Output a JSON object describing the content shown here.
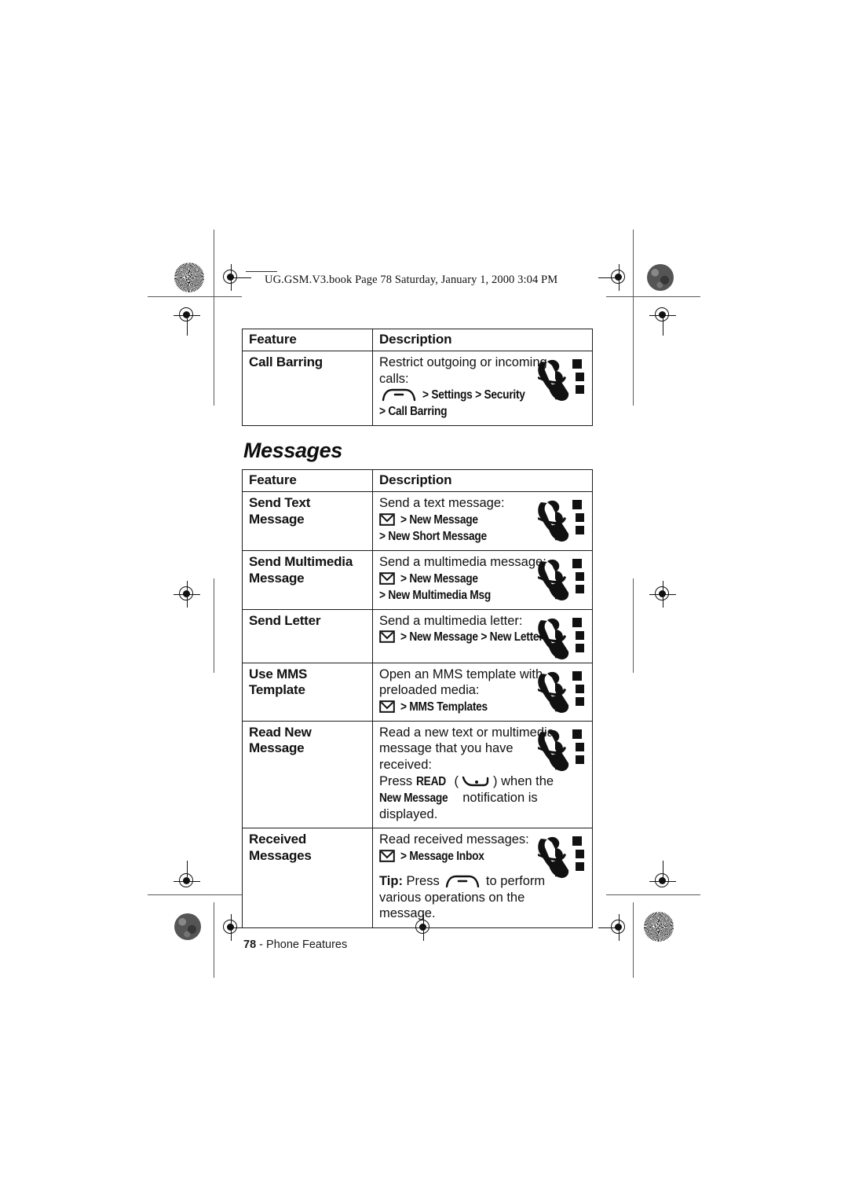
{
  "header": {
    "slug": "UG.GSM.V3.book  Page 78  Saturday, January 1, 2000  3:04 PM"
  },
  "table_call": {
    "headers": {
      "feature": "Feature",
      "description": "Description"
    },
    "rows": [
      {
        "feature": "Call Barring",
        "lines": [
          {
            "text": "Restrict outgoing or incoming"
          },
          {
            "text": "calls:"
          },
          {
            "icon": "menu-key-icon",
            "screen_before": "",
            "text": "> Settings > Security",
            "screen": true
          },
          {
            "text": "> Call Barring",
            "screen": true
          }
        ],
        "phone_icon": "flip-phone-icon"
      }
    ]
  },
  "section": {
    "title": "Messages"
  },
  "table_messages": {
    "headers": {
      "feature": "Feature",
      "description": "Description"
    },
    "rows": [
      {
        "feature": "Send Text Message",
        "lines": [
          {
            "text": "Send a text message:"
          },
          {
            "icon": "envelope-icon",
            "text": "> New Message",
            "screen": true
          },
          {
            "text": "> New Short Message",
            "screen": true
          }
        ],
        "phone_icon": "flip-phone-icon"
      },
      {
        "feature": "Send Multimedia Message",
        "lines": [
          {
            "text": "Send a multimedia message:"
          },
          {
            "icon": "envelope-icon",
            "text": "> New Message",
            "screen": true
          },
          {
            "text": "> New Multimedia Msg",
            "screen": true
          }
        ],
        "phone_icon": "flip-phone-icon"
      },
      {
        "feature": "Send Letter",
        "lines": [
          {
            "text": "Send a multimedia letter:"
          },
          {
            "icon": "envelope-icon",
            "text": "> New Message > New Letter",
            "screen": true
          }
        ],
        "phone_icon": "flip-phone-icon"
      },
      {
        "feature": "Use MMS Template",
        "lines": [
          {
            "text": "Open an MMS template with"
          },
          {
            "text": "preloaded media:"
          },
          {
            "icon": "envelope-icon",
            "text": "> MMS Templates",
            "screen": true
          }
        ],
        "phone_icon": "flip-phone-icon"
      },
      {
        "feature": "Read New Message",
        "lines": [
          {
            "text": "Read a new text or multimedia"
          },
          {
            "text": "message that you have"
          },
          {
            "text": "received:"
          },
          {
            "text": "Press READ (   ) when the",
            "mixed": "read-key"
          },
          {
            "text": "New Message notification is displayed.",
            "mixed": "new-message-note"
          }
        ],
        "phone_icon": "flip-phone-icon"
      },
      {
        "feature": "Received Messages",
        "lines": [
          {
            "text": "Read received messages:"
          },
          {
            "icon": "envelope-icon",
            "text": "> Message Inbox",
            "screen": true
          },
          {
            "text": "Tip: Press    to perform",
            "mixed": "tip-line"
          },
          {
            "text": "various operations on the"
          },
          {
            "text": "message."
          }
        ],
        "phone_icon": "flip-phone-icon"
      }
    ]
  },
  "strings": {
    "call_barring_l1": "Restrict outgoing or incoming",
    "call_barring_l2": "calls:",
    "call_barring_path1": "> Settings > Security",
    "call_barring_path2": "> Call Barring",
    "stm_l1": "Send a text message:",
    "stm_p1": "> New Message",
    "stm_p2": "> New Short Message",
    "smm_l1": "Send a multimedia message:",
    "smm_p1": "> New Message",
    "smm_p2": "> New Multimedia Msg",
    "sl_l1": "Send a multimedia letter:",
    "sl_p1": "> New Message > New Letter",
    "mms_l1": "Open an MMS template with",
    "mms_l2": "preloaded media:",
    "mms_p1": "> MMS Templates",
    "rnm_l1": "Read a new text or multimedia",
    "rnm_l2": "message that you have",
    "rnm_l3": "received:",
    "rnm_press": "Press",
    "rnm_read": "READ",
    "rnm_open": "(",
    "rnm_close": ")",
    "rnm_when": "when the",
    "rnm_newmsg": "New Message",
    "rnm_tail": "notification is displayed.",
    "rm_l1": "Read received messages:",
    "rm_p1": "> Message Inbox",
    "rm_tip": "Tip:",
    "rm_press": "Press",
    "rm_perform": "to perform",
    "rm_l2": "various operations on the",
    "rm_l3": "message."
  },
  "footer": {
    "page_number": "78",
    "separator": " - ",
    "label": "Phone Features"
  }
}
